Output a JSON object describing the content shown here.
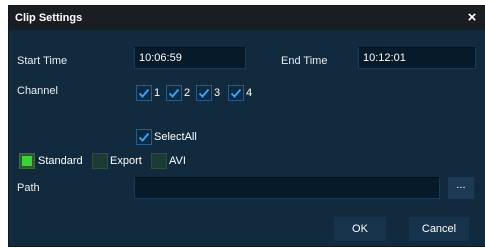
{
  "window": {
    "title": "Clip Settings",
    "close_label": "×"
  },
  "time": {
    "start_label": "Start Time",
    "start_value": "10:06:59",
    "end_label": "End Time",
    "end_value": "10:12:01"
  },
  "channel": {
    "label": "Channel",
    "options": [
      {
        "label": "1",
        "checked": true
      },
      {
        "label": "2",
        "checked": true
      },
      {
        "label": "3",
        "checked": true
      },
      {
        "label": "4",
        "checked": true
      }
    ],
    "select_all_label": "SelectAll",
    "select_all_checked": true
  },
  "format": {
    "options": [
      {
        "label": "Standard",
        "selected": true
      },
      {
        "label": "Export",
        "selected": false
      },
      {
        "label": "AVI",
        "selected": false
      }
    ]
  },
  "path": {
    "label": "Path",
    "value": "",
    "browse_label": "..."
  },
  "buttons": {
    "ok": "OK",
    "cancel": "Cancel"
  },
  "colors": {
    "check": "#3aa8ff",
    "radio_selected": "#3cd43c",
    "dialog_bg": "#122a3e"
  }
}
